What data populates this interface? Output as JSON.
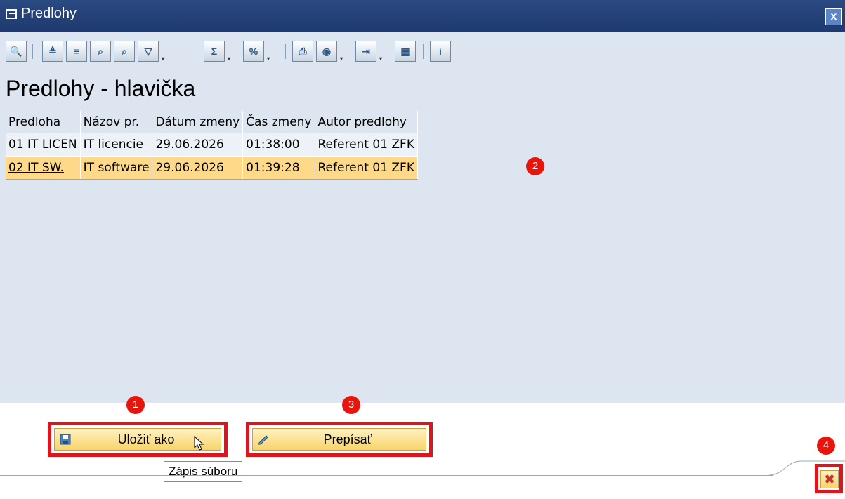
{
  "window": {
    "title": "Predlohy",
    "close_symbol": "x"
  },
  "toolbar": {
    "icons": [
      "details-icon",
      "sort-asc-icon",
      "sort-desc-icon",
      "find-icon",
      "find-next-icon",
      "filter-icon",
      "sum-icon",
      "subtotal-icon",
      "print-icon",
      "view-icon",
      "export-icon",
      "layout-icon",
      "info-icon"
    ]
  },
  "heading": "Predlohy - hlavička",
  "table": {
    "columns": [
      "Predloha",
      "Názov pr.",
      "Dátum zmeny",
      "Čas zmeny",
      "Autor predlohy"
    ],
    "rows": [
      [
        "01 IT LICEN",
        "IT licencie",
        "29.06.2026",
        "01:38:00",
        "Referent 01 ZFK"
      ],
      [
        "02 IT SW.",
        "IT software",
        "29.06.2026",
        "01:39:28",
        "Referent 01 ZFK"
      ]
    ],
    "selected_row": 1
  },
  "markers": [
    "1",
    "2",
    "3",
    "4"
  ],
  "buttons": {
    "save_as": "Uložiť ako",
    "overwrite": "Prepísať"
  },
  "tooltip": "Zápis súboru",
  "colors": {
    "title_bar": "#1e3a6e",
    "marker": "#e8150c",
    "highlight_box": "#e0141a",
    "selected_row": "#ffd98a"
  }
}
